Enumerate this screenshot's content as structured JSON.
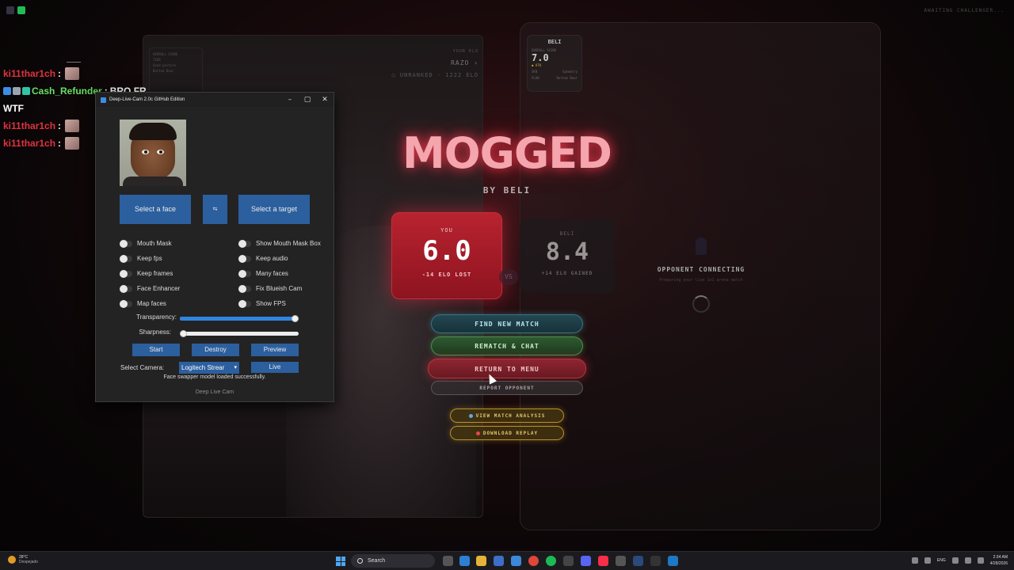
{
  "top": {
    "awaiting": "AWAITING CHALLENGER..."
  },
  "video_left": {
    "mini_card": {
      "label1": "OVERALL SCORE",
      "label2": "TIER",
      "label3": "Good posture",
      "label4": "Bottom Bear"
    },
    "your_elo": {
      "label": "YOUR ELO",
      "name": "RAZO ›",
      "rank": "○ UNRANKED · 1222 ELO"
    }
  },
  "beli_card": {
    "name": "BELI",
    "overall_label": "OVERALL SCORE",
    "score": "7.0",
    "tier": "● HTN",
    "row1_left": "SKN",
    "row1_right": "Symmetry",
    "row2_left": "PLAN",
    "row2_right": "Bottom Bear"
  },
  "game": {
    "title": "MOGGED",
    "subtitle": "BY BELI",
    "you": {
      "label": "YOU",
      "score": "6.0",
      "elo": "-14 ELO LOST"
    },
    "vs": "VS",
    "opponent": {
      "label": "BELI",
      "score": "8.4",
      "elo": "+14 ELO GAINED"
    },
    "buttons": {
      "find": "FIND NEW MATCH",
      "rematch": "REMATCH & CHAT",
      "return": "RETURN TO MENU",
      "report": "REPORT OPPONENT",
      "analysis": "VIEW MATCH ANALYSIS",
      "replay": "DOWNLOAD REPLAY"
    },
    "opponent_status": {
      "title": "OPPONENT CONNECTING",
      "sub": "Preparing your live 1v1 arena match"
    }
  },
  "chat": {
    "messages": [
      {
        "user": "ki11thar1ch",
        "text": "",
        "emote": true
      },
      {
        "user": "Cash_Refunder",
        "text": "BRO FR",
        "emote": false,
        "green": true
      },
      {
        "user": "",
        "text": "WTF",
        "emote": false
      },
      {
        "user": "ki11thar1ch",
        "text": "",
        "emote": true
      },
      {
        "user": "ki11thar1ch",
        "text": "",
        "emote": true
      }
    ]
  },
  "deep_live_cam": {
    "title": "Deep-Live-Cam 2.0c GitHub Edition",
    "select_face": "Select a face",
    "swap_icon": "⇆",
    "select_target": "Select a target",
    "toggles_left": [
      "Mouth Mask",
      "Keep fps",
      "Keep frames",
      "Face Enhancer",
      "Map faces"
    ],
    "toggles_right": [
      "Show Mouth Mask Box",
      "Keep audio",
      "Many faces",
      "Fix Blueish Cam",
      "Show FPS"
    ],
    "transparency_label": "Transparency:",
    "transparency_value": 1.0,
    "sharpness_label": "Sharpness:",
    "sharpness_value": 0.0,
    "start": "Start",
    "destroy": "Destroy",
    "preview": "Preview",
    "camera_label": "Select Camera:",
    "camera_value": "Logitech Strear",
    "live": "Live",
    "status": "Face swapper model loaded successfully.",
    "footer": "Deep Live Cam"
  },
  "taskbar": {
    "temp": "28°C",
    "weather": "Despejado",
    "search": "Search",
    "lang": "ENG",
    "time": "2:34 AM",
    "date": "4/28/2026"
  }
}
